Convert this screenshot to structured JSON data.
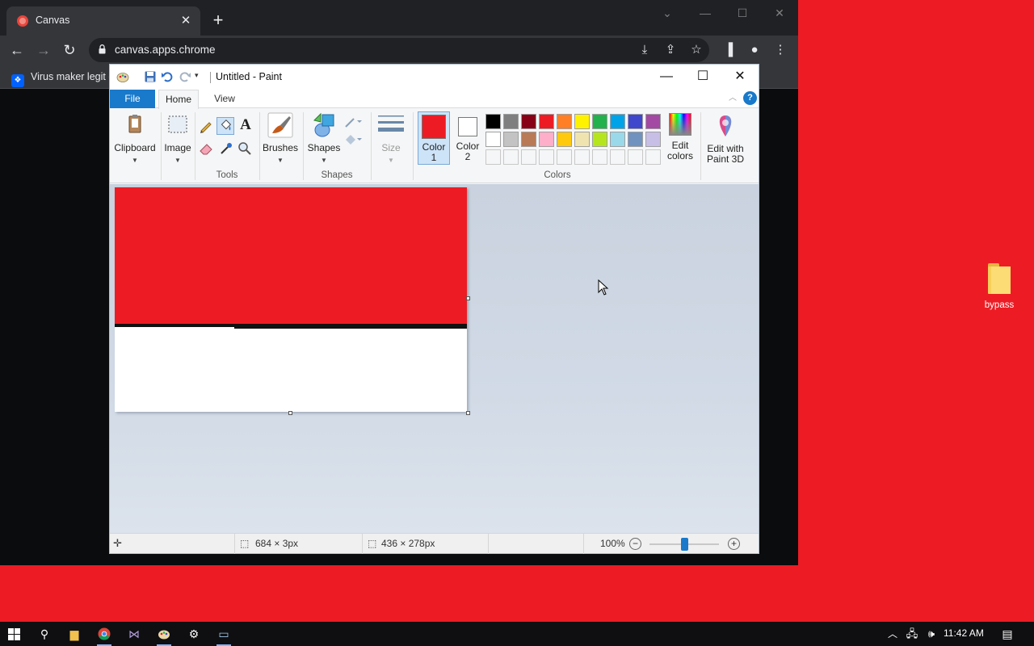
{
  "browser": {
    "tab_title": "Canvas",
    "url": "canvas.apps.chrome",
    "bookmark_label": "Virus maker legit c"
  },
  "paint": {
    "window_title": "Untitled - Paint",
    "tabs": {
      "file": "File",
      "home": "Home",
      "view": "View"
    },
    "help": "?",
    "ribbon": {
      "clipboard": "Clipboard",
      "image": "Image",
      "tools_group": "Tools",
      "brushes": "Brushes",
      "shapes": "Shapes",
      "shapes_group": "Shapes",
      "size": "Size",
      "color1": "Color 1",
      "color2": "Color 2",
      "colors_group": "Colors",
      "edit_colors": "Edit colors",
      "edit_paint3d": "Edit with Paint 3D",
      "text_tool_glyph": "A"
    },
    "color1_value": "#ed1c24",
    "color2_value": "#ffffff",
    "palette_row1": [
      "#000000",
      "#7f7f7f",
      "#880015",
      "#ed1c24",
      "#ff7f27",
      "#fff200",
      "#22b14c",
      "#00a2e8",
      "#3f48cc",
      "#a349a4"
    ],
    "palette_row2": [
      "#ffffff",
      "#c3c3c3",
      "#b97a57",
      "#ffaec9",
      "#ffc90e",
      "#efe4b0",
      "#b5e61d",
      "#99d9ea",
      "#7092be",
      "#c8bfe7"
    ],
    "status": {
      "selection_size": "684 × 3px",
      "image_size": "436 × 278px",
      "zoom": "100%",
      "zoom_level": 0.5
    }
  },
  "desktop": {
    "folder_label": "bypass"
  },
  "taskbar": {
    "time": "11:42 AM"
  }
}
